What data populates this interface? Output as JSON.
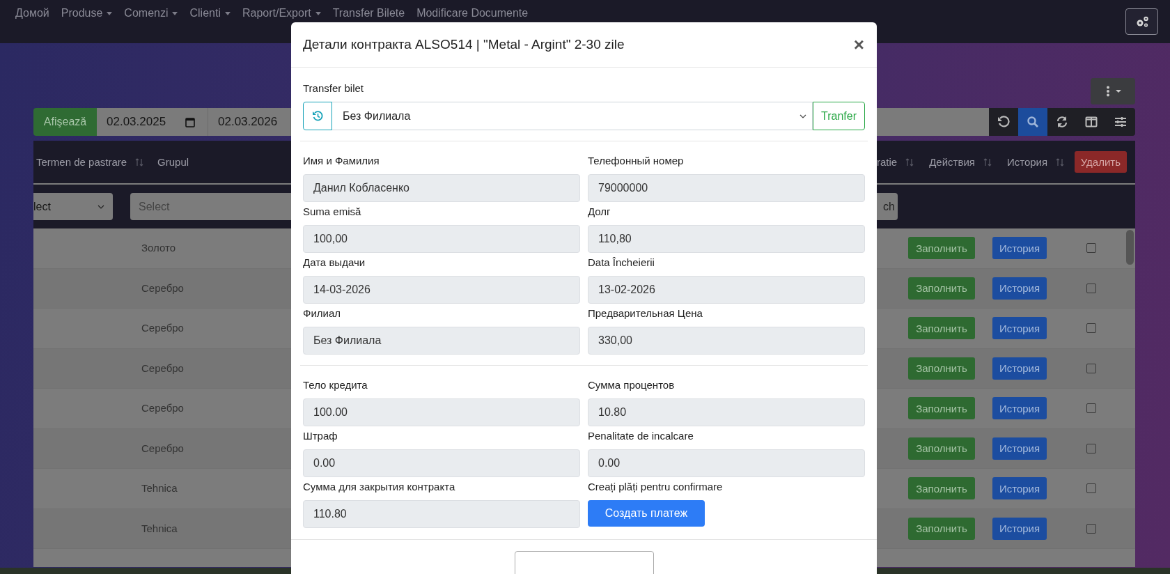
{
  "nav": {
    "items": [
      {
        "label": "Домой",
        "dropdown": false
      },
      {
        "label": "Produse",
        "dropdown": true
      },
      {
        "label": "Comenzi",
        "dropdown": true
      },
      {
        "label": "Clienti",
        "dropdown": true
      },
      {
        "label": "Raport/Export",
        "dropdown": true
      },
      {
        "label": "Transfer Bilete",
        "dropdown": false
      },
      {
        "label": "Modificare Documente",
        "dropdown": false
      }
    ]
  },
  "toolbar": {
    "show_button": "Afişează",
    "date_from": "02.03.2025",
    "date_to": "02.03.2026"
  },
  "table": {
    "columns_left": [
      {
        "label": "Termen de pastrare",
        "sortable": true
      },
      {
        "label": "Grupul",
        "sortable": false
      }
    ],
    "columns_right": [
      {
        "label": "ratie",
        "sortable": true
      },
      {
        "label": "Действия",
        "sortable": true
      },
      {
        "label": "История",
        "sortable": true
      }
    ],
    "delete_button": "Удалить",
    "filters": {
      "select_value": "lect",
      "input_placeholder": "Select",
      "search_button": "ch"
    },
    "rows": [
      {
        "group": "Золото",
        "fill_button": "Заполнить",
        "history_button": "История",
        "checked": false
      },
      {
        "group": "Серебро",
        "fill_button": "Заполнить",
        "history_button": "История",
        "checked": false
      },
      {
        "group": "Серебро",
        "fill_button": "Заполнить",
        "history_button": "История",
        "checked": false
      },
      {
        "group": "Серебро",
        "fill_button": "Заполнить",
        "history_button": "История",
        "checked": false
      },
      {
        "group": "Серебро",
        "fill_button": "Заполнить",
        "history_button": "История",
        "checked": false
      },
      {
        "group": "Серебро",
        "fill_button": "Заполнить",
        "history_button": "История",
        "checked": false
      },
      {
        "group": "Tehnica",
        "fill_button": "Заполнить",
        "history_button": "История",
        "checked": false
      },
      {
        "group": "Tehnica",
        "fill_button": "Заполнить",
        "history_button": "История",
        "checked": false
      }
    ]
  },
  "modal": {
    "title": "Детали контракта ALSO514 | \"Metal - Argint\" 2-30 zile",
    "close": "×",
    "transfer": {
      "label": "Transfer bilet",
      "branch": "Без Филиала",
      "button": "Tranfer"
    },
    "sections": [
      [
        {
          "kind": "field",
          "label": "Имя и Фамилия",
          "value": "Данил Кобласенко"
        },
        {
          "kind": "field",
          "label": "Телефонный номер",
          "value": "79000000"
        },
        {
          "kind": "field",
          "label": "Suma emisă",
          "value": "100,00"
        },
        {
          "kind": "field",
          "label": "Долг",
          "value": "110,80"
        },
        {
          "kind": "field",
          "label": "Дата выдачи",
          "value": "14-03-2026"
        },
        {
          "kind": "field",
          "label": "Data Încheierii",
          "value": "13-02-2026"
        },
        {
          "kind": "field",
          "label": "Филиал",
          "value": "Без Филиала"
        },
        {
          "kind": "field",
          "label": "Предварительная Цена",
          "value": "330,00"
        }
      ],
      [
        {
          "kind": "field",
          "label": "Тело кредита",
          "value": "100.00"
        },
        {
          "kind": "field",
          "label": "Сумма процентов",
          "value": "10.80"
        },
        {
          "kind": "field",
          "label": "Штраф",
          "value": "0.00"
        },
        {
          "kind": "field",
          "label": "Penalitate de incalcare",
          "value": "0.00"
        },
        {
          "kind": "field",
          "label": "Сумма для закрытия контракта",
          "value": "110.80"
        },
        {
          "kind": "button",
          "label": "Creați plăți pentru confirmare",
          "value": "Создать платеж"
        }
      ]
    ]
  }
}
